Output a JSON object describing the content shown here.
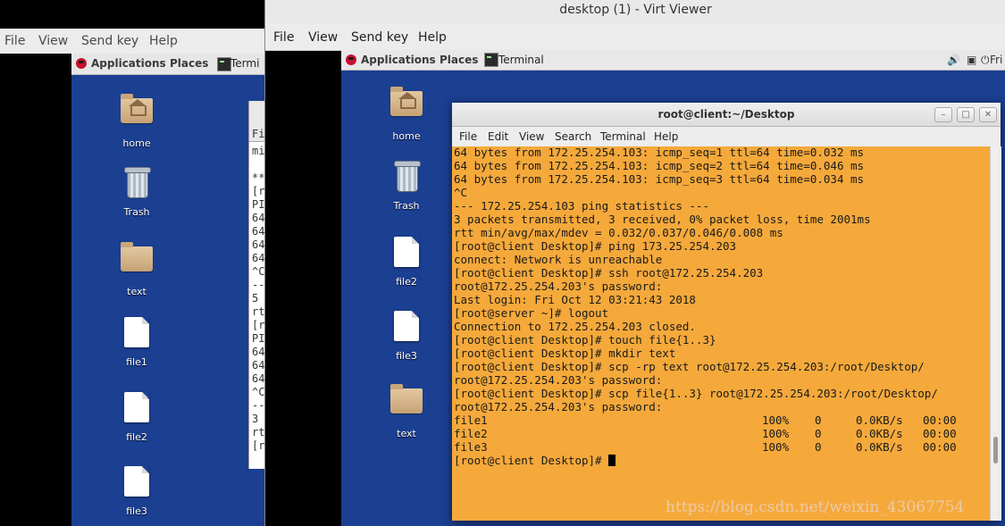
{
  "back_window": {
    "menu": [
      "File",
      "View",
      "Send key",
      "Help"
    ],
    "topbar": {
      "applications": "Applications",
      "places": "Places",
      "task": "Termi"
    },
    "desktop_icons": [
      {
        "label": "home"
      },
      {
        "label": "Trash"
      },
      {
        "label": "text"
      },
      {
        "label": "file1"
      },
      {
        "label": "file2"
      },
      {
        "label": "file3"
      }
    ],
    "clipped_terminal_lines": [
      "Fi",
      "mi",
      "",
      "**",
      "[r",
      "PI",
      "64",
      "64",
      "64",
      "64",
      "^C",
      "--",
      "5",
      "rt",
      "[r",
      "PI",
      "64",
      "64",
      "64",
      "^C",
      "--",
      "3",
      "rt",
      "[r"
    ]
  },
  "front_window": {
    "title": "desktop (1) - Virt Viewer",
    "menu": [
      "File",
      "View",
      "Send key",
      "Help"
    ],
    "topbar": {
      "applications": "Applications",
      "places": "Places",
      "task": "Terminal",
      "clock": "Fri"
    },
    "desktop_icons": [
      {
        "label": "home"
      },
      {
        "label": "Trash"
      },
      {
        "label": "file2"
      },
      {
        "label": "file3"
      },
      {
        "label": "text"
      }
    ],
    "terminal": {
      "title": "root@client:~/Desktop",
      "menu": [
        "File",
        "Edit",
        "View",
        "Search",
        "Terminal",
        "Help"
      ],
      "lines": [
        "64 bytes from 172.25.254.103: icmp_seq=1 ttl=64 time=0.032 ms",
        "64 bytes from 172.25.254.103: icmp_seq=2 ttl=64 time=0.046 ms",
        "64 bytes from 172.25.254.103: icmp_seq=3 ttl=64 time=0.034 ms",
        "^C",
        "--- 172.25.254.103 ping statistics ---",
        "3 packets transmitted, 3 received, 0% packet loss, time 2001ms",
        "rtt min/avg/max/mdev = 0.032/0.037/0.046/0.008 ms",
        "[root@client Desktop]# ping 173.25.254.203",
        "connect: Network is unreachable",
        "[root@client Desktop]# ssh root@172.25.254.203",
        "root@172.25.254.203's password:",
        "Last login: Fri Oct 12 03:21:43 2018",
        "[root@server ~]# logout",
        "Connection to 172.25.254.203 closed.",
        "[root@client Desktop]# touch file{1..3}",
        "[root@client Desktop]# mkdir text",
        "[root@client Desktop]# scp -rp text root@172.25.254.203:/root/Desktop/",
        "root@172.25.254.203's password:",
        "[root@client Desktop]# scp file{1..3} root@172.25.254.203:/root/Desktop/",
        "root@172.25.254.203's password:"
      ],
      "transfers": [
        {
          "file": "file1",
          "percent": "100%",
          "size": "0",
          "rate": "0.0KB/s",
          "eta": "00:00"
        },
        {
          "file": "file2",
          "percent": "100%",
          "size": "0",
          "rate": "0.0KB/s",
          "eta": "00:00"
        },
        {
          "file": "file3",
          "percent": "100%",
          "size": "0",
          "rate": "0.0KB/s",
          "eta": "00:00"
        }
      ],
      "prompt": "[root@client Desktop]# "
    }
  },
  "watermark": "https://blog.csdn.net/weixin_43067754",
  "colors": {
    "desktop": "#1b3f91",
    "terminal_bg": "#f5a93b"
  }
}
